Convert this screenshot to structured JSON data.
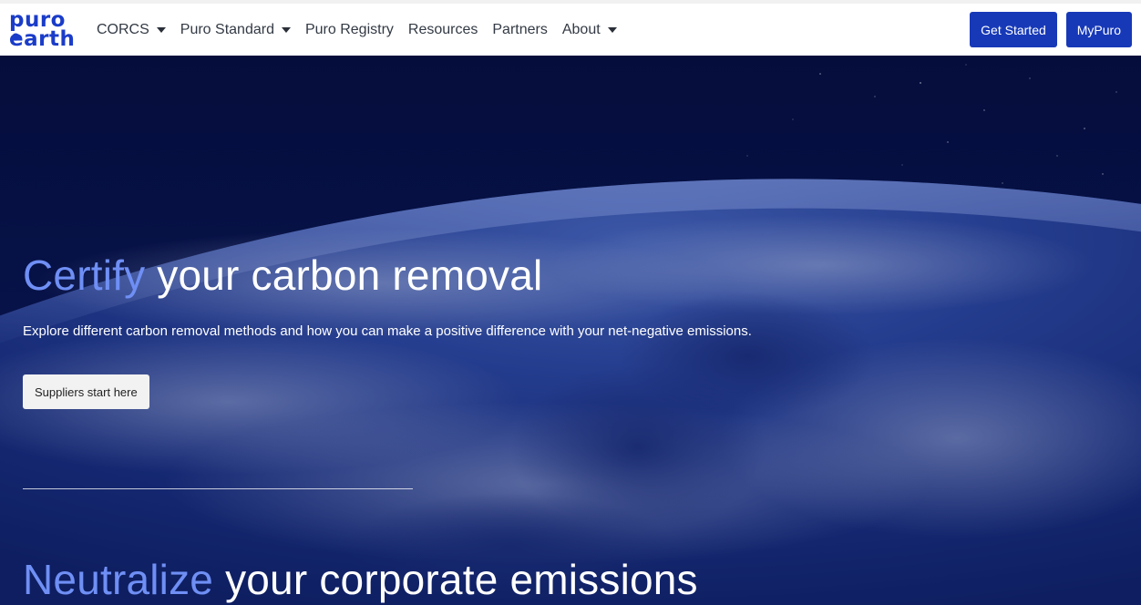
{
  "nav": {
    "logo_line1": "puro •",
    "logo_line2": "earth",
    "items": [
      {
        "label": "CORCS",
        "dropdown": true
      },
      {
        "label": "Puro Standard",
        "dropdown": true
      },
      {
        "label": "Puro Registry",
        "dropdown": false
      },
      {
        "label": "Resources",
        "dropdown": false
      },
      {
        "label": "Partners",
        "dropdown": false
      },
      {
        "label": "About",
        "dropdown": true
      }
    ],
    "get_started_label": "Get Started",
    "mypuro_label": "MyPuro"
  },
  "hero": {
    "headline_accent": "Certify",
    "headline_rest": " your carbon removal",
    "subtext": "Explore different carbon removal methods and how you can make a positive difference with your net-negative emissions.",
    "cta_label": "Suppliers start here",
    "headline2_accent": "Neutralize",
    "headline2_rest": " your corporate emissions"
  },
  "colors": {
    "brand_blue": "#1739b8",
    "accent_blue": "#6f8ff5",
    "space_dark": "#06103f"
  }
}
